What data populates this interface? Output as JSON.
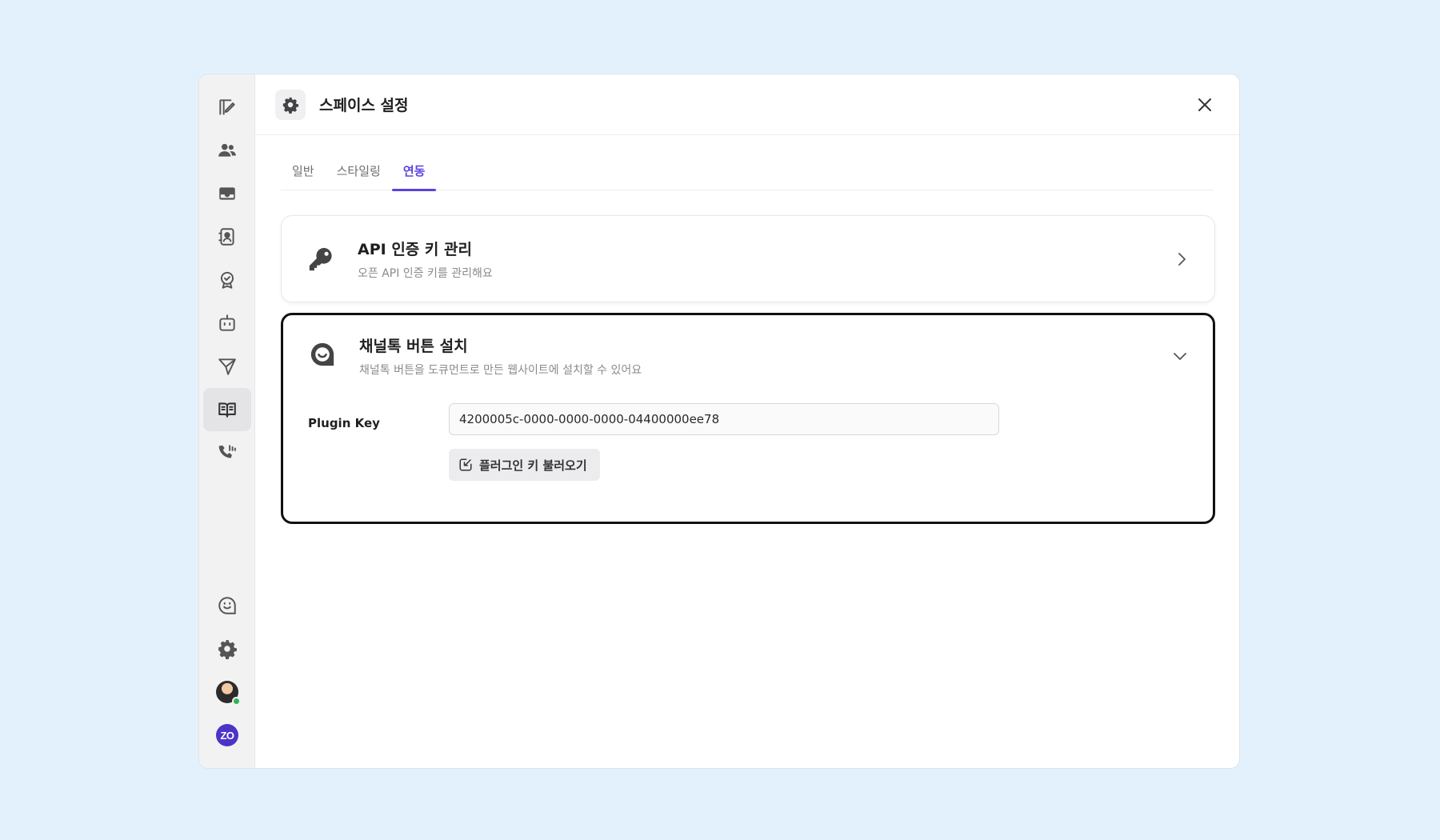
{
  "header": {
    "title": "스페이스 설정"
  },
  "tabs": [
    {
      "label": "일반"
    },
    {
      "label": "스타일링"
    },
    {
      "label": "연동"
    }
  ],
  "active_tab": "연동",
  "api_card": {
    "title": "API 인증 키 관리",
    "description": "오픈 API 인증 키를 관리해요",
    "icon": "key-icon"
  },
  "channel_card": {
    "title": "채널톡 버튼 설치",
    "description": "채널톡 버튼을 도큐먼트로 만든 웹사이트에 설치할 수 있어요",
    "icon": "channel-talk-icon",
    "plugin_key_label": "Plugin Key",
    "plugin_key_value": "4200005c-0000-0000-0000-04400000ee78",
    "load_button_label": "플러그인 키 불러오기"
  },
  "sidebar": {
    "items": [
      {
        "icon": "compose-icon"
      },
      {
        "icon": "team-icon"
      },
      {
        "icon": "inbox-icon"
      },
      {
        "icon": "contacts-icon"
      },
      {
        "icon": "badge-icon"
      },
      {
        "icon": "bot-icon"
      },
      {
        "icon": "send-icon"
      },
      {
        "icon": "document-book-icon",
        "active": true
      },
      {
        "icon": "phone-icon"
      }
    ],
    "bottom": [
      {
        "icon": "chat-face-icon"
      },
      {
        "icon": "gear-icon"
      },
      {
        "icon": "user-avatar"
      },
      {
        "icon": "workspace-badge",
        "label": "ZO"
      }
    ]
  },
  "colors": {
    "accent": "#5b43e0",
    "background": "#e3f1fd",
    "online": "#2fb35a",
    "workspace": "#4b34c8"
  }
}
